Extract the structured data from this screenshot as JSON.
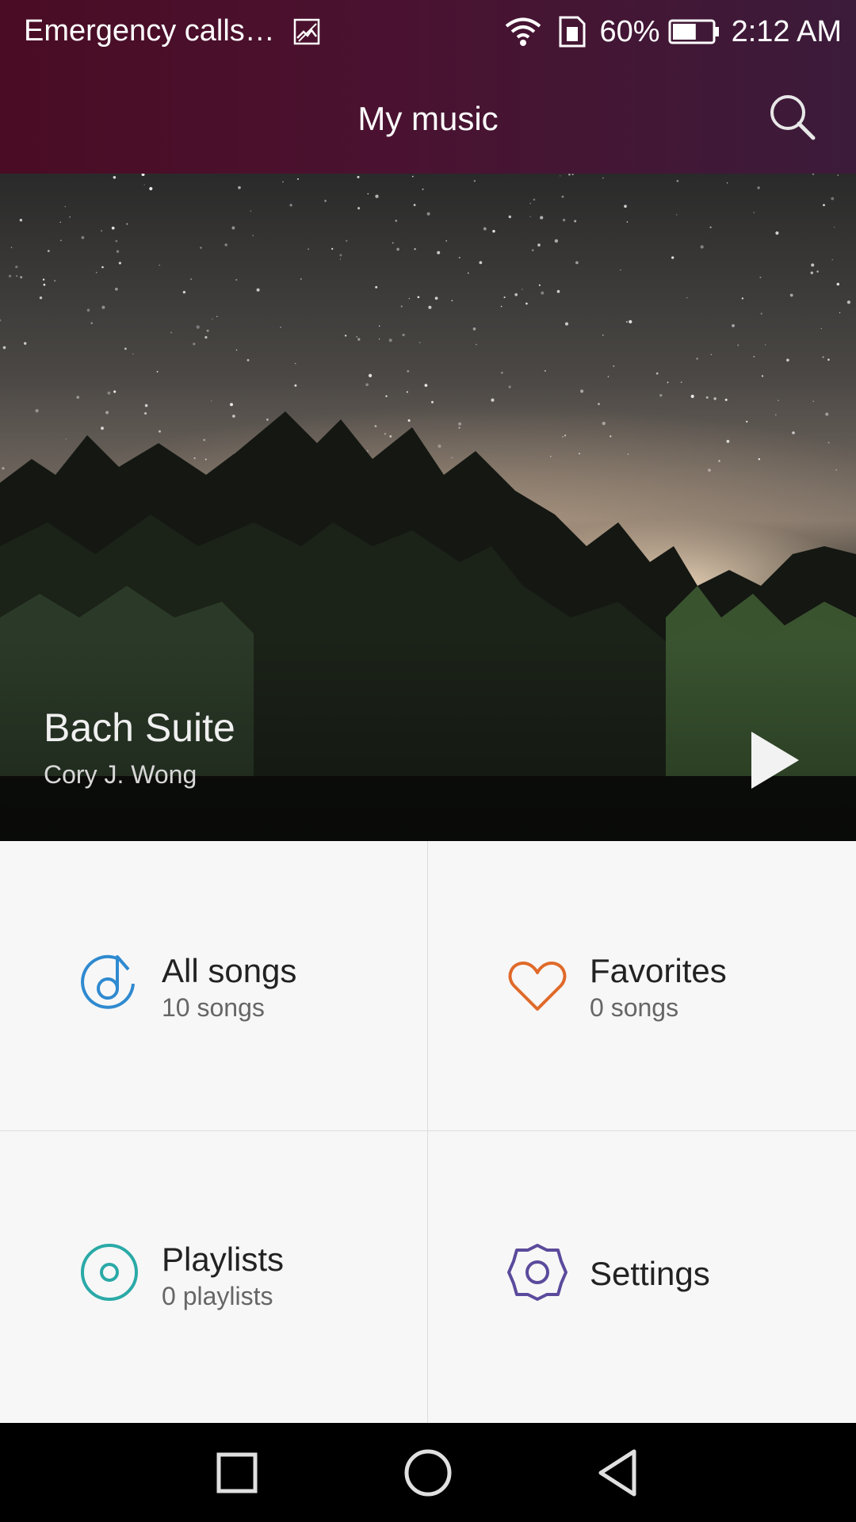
{
  "status_bar": {
    "carrier_text": "Emergency calls…",
    "battery_percent": "60%",
    "battery_level": 0.6,
    "time": "2:12 AM"
  },
  "header": {
    "title": "My music",
    "search_icon": "search-icon"
  },
  "now_playing": {
    "title": "Bach Suite",
    "artist": "Cory J. Wong",
    "play_icon": "play-icon"
  },
  "tiles": {
    "all_songs": {
      "label": "All songs",
      "sub": "10 songs",
      "icon": "music-note-icon",
      "color": "#2f8ad0"
    },
    "favorites": {
      "label": "Favorites",
      "sub": "0 songs",
      "icon": "heart-icon",
      "color": "#e06a2a"
    },
    "playlists": {
      "label": "Playlists",
      "sub": "0 playlists",
      "icon": "disc-icon",
      "color": "#2aaaa7"
    },
    "settings": {
      "label": "Settings",
      "icon": "gear-icon",
      "color": "#5b4a9c"
    }
  },
  "nav_bar": {
    "recents_icon": "square-icon",
    "home_icon": "circle-icon",
    "back_icon": "triangle-back-icon"
  },
  "colors": {
    "header_gradient_start": "#4a0c24",
    "header_gradient_end": "#3c1b3a",
    "grid_background": "#f7f7f7"
  }
}
